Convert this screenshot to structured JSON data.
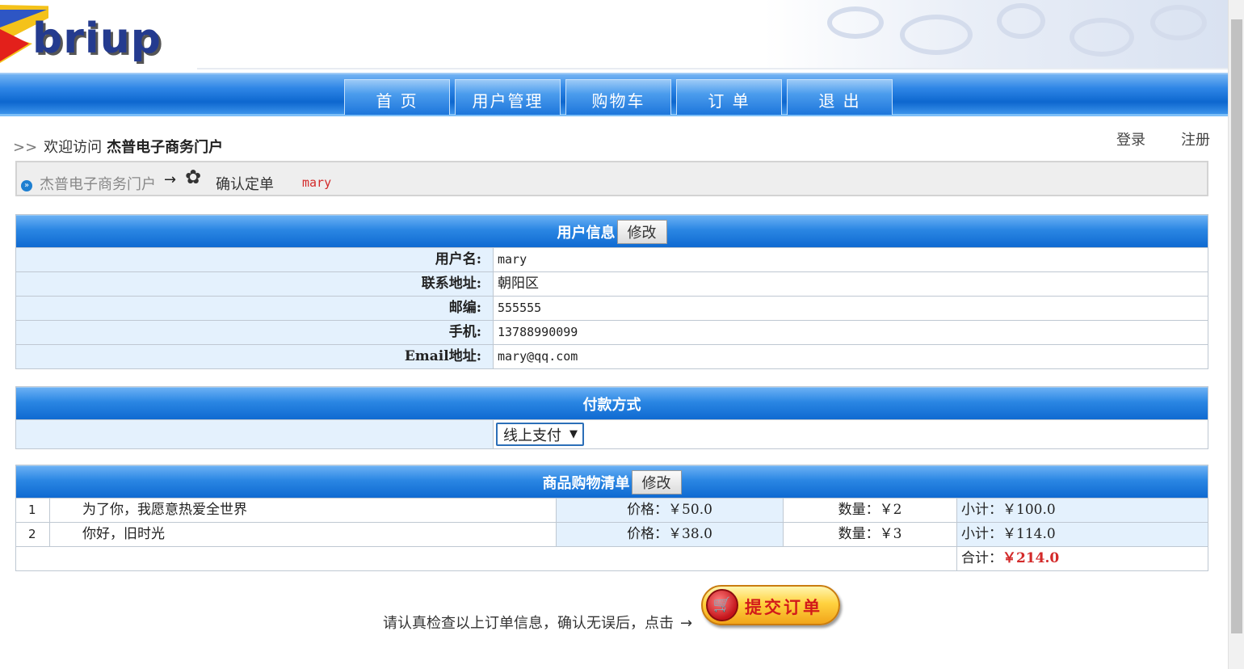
{
  "header": {
    "logo_text": "briup"
  },
  "nav": {
    "tabs": [
      "首 页",
      "用户管理",
      "购物车",
      "订 单",
      "退 出"
    ]
  },
  "welcome": {
    "arrows": ">>",
    "prefix": "欢迎访问",
    "site": "杰普电子商务门户"
  },
  "toplinks": {
    "login": "登录",
    "register": "注册"
  },
  "breadcrumb": {
    "home": "杰普电子商务门户",
    "arrow": "→",
    "current": "确认定单",
    "user": "mary"
  },
  "user_info": {
    "title": "用户信息",
    "edit": "修改",
    "rows": [
      {
        "label": "用户名:",
        "value": "mary"
      },
      {
        "label": "联系地址:",
        "value": "朝阳区"
      },
      {
        "label": "邮编:",
        "value": "555555"
      },
      {
        "label": "手机:",
        "value": "13788990099"
      },
      {
        "label": "Email地址:",
        "value": "mary@qq.com"
      }
    ]
  },
  "payment": {
    "title": "付款方式",
    "selected": "线上支付"
  },
  "cart": {
    "title": "商品购物清单",
    "edit": "修改",
    "items": [
      {
        "num": "1",
        "name": "为了你，我愿意热爱全世界",
        "price": "价格：￥50.0",
        "qty": "数量：￥2",
        "subtotal": "小计：￥100.0"
      },
      {
        "num": "2",
        "name": "你好，旧时光",
        "price": "价格：￥38.0",
        "qty": "数量：￥3",
        "subtotal": "小计：￥114.0"
      }
    ],
    "total_label": "合计：",
    "total_value": "￥214.0"
  },
  "confirm": {
    "text": "请认真检查以上订单信息，确认无误后，点击",
    "arrow": "→",
    "submit": "提交订单"
  },
  "colors": {
    "nav_blue": "#0d67cf",
    "label_bg": "#e4f1fd",
    "accent_red": "#d32a2a"
  }
}
